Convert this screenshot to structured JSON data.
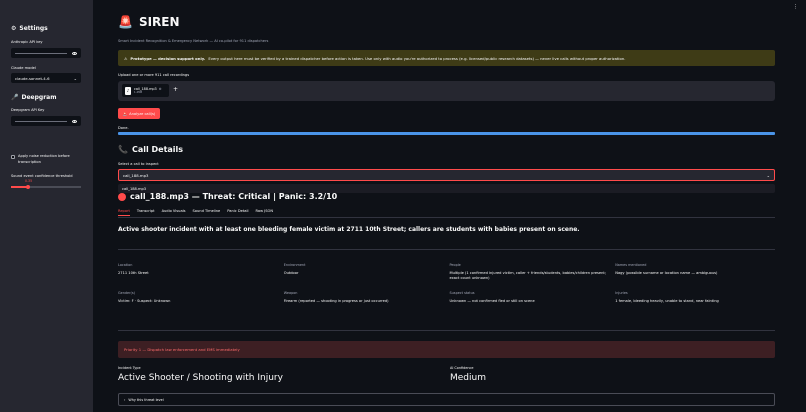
{
  "sidebar": {
    "settings_title": "Settings",
    "anthropic_label": "Anthropic API key",
    "claude_model_label": "Claude model",
    "claude_model_value": "claude-sonnet-4-6",
    "deepgram_title": "Deepgram",
    "deepgram_label": "Deepgram API Key",
    "noise_reduction_label": "Apply noise reduction before transcription",
    "threshold_label": "Sound event confidence threshold",
    "threshold_value": "0.35"
  },
  "header": {
    "title": "SIREN",
    "subtitle": "Smart Incident Recognition & Emergency Network — AI co-pilot for 911 dispatchers"
  },
  "warning": {
    "bold": "Prototype — decision support only.",
    "text": "Every output here must be verified by a trained dispatcher before action is taken. Use only with audio you're authorized to process (e.g. licensed/public research datasets) — never live calls without proper authorization."
  },
  "upload": {
    "label": "Upload one or more 911 call recordings",
    "file_name": "call_188.mp3",
    "file_size": "1.4MB"
  },
  "analyze_button": "Analyze call(s)",
  "status": {
    "done": "Done.",
    "progress": 1.0
  },
  "call_details": {
    "title": "Call Details",
    "select_label": "Select a call to inspect",
    "select_value": "call_188.mp3",
    "dropdown_option": "call_188.mp3",
    "overlap_title": "call_188.mp3 — Threat: Critical | Panic: 3.2/10"
  },
  "tabs": [
    "Report",
    "Transcript",
    "Audio Visuals",
    "Sound Timeline",
    "Panic Detail",
    "Raw JSON"
  ],
  "summary": "Active shooter incident with at least one bleeding female victim at 2711 10th Street; callers are students with babies present on scene.",
  "fields": [
    {
      "label": "Location",
      "value": "2711 10th Street"
    },
    {
      "label": "Environment",
      "value": "Outdoor"
    },
    {
      "label": "People",
      "value": "Multiple (1 confirmed injured victim, caller + friends/students, babies/children present; exact count unknown)"
    },
    {
      "label": "Names mentioned",
      "value": "Nagy (possible surname or location name — ambiguous)"
    },
    {
      "label": "Gender(s)",
      "value": "Victim: F · Suspect: Unknown"
    },
    {
      "label": "Weapon",
      "value": "Firearm (reported — shooting in progress or just occurred)"
    },
    {
      "label": "Suspect status",
      "value": "Unknown — not confirmed fled or still on scene"
    },
    {
      "label": "Injuries",
      "value": "1 female, bleeding heavily, unable to stand, near fainting"
    }
  ],
  "priority": "Priority 1 — Dispatch law enforcement and EMS immediately",
  "incident": {
    "type_label": "Incident Type",
    "type_value": "Active Shooter / Shooting with Injury",
    "confidence_label": "AI Confidence",
    "confidence_value": "Medium"
  },
  "expander_label": "Why this threat level",
  "colors": {
    "accent": "#ff4b4b",
    "background": "#0e1117",
    "sidebar": "#262730",
    "progress": "#4a94e8"
  }
}
